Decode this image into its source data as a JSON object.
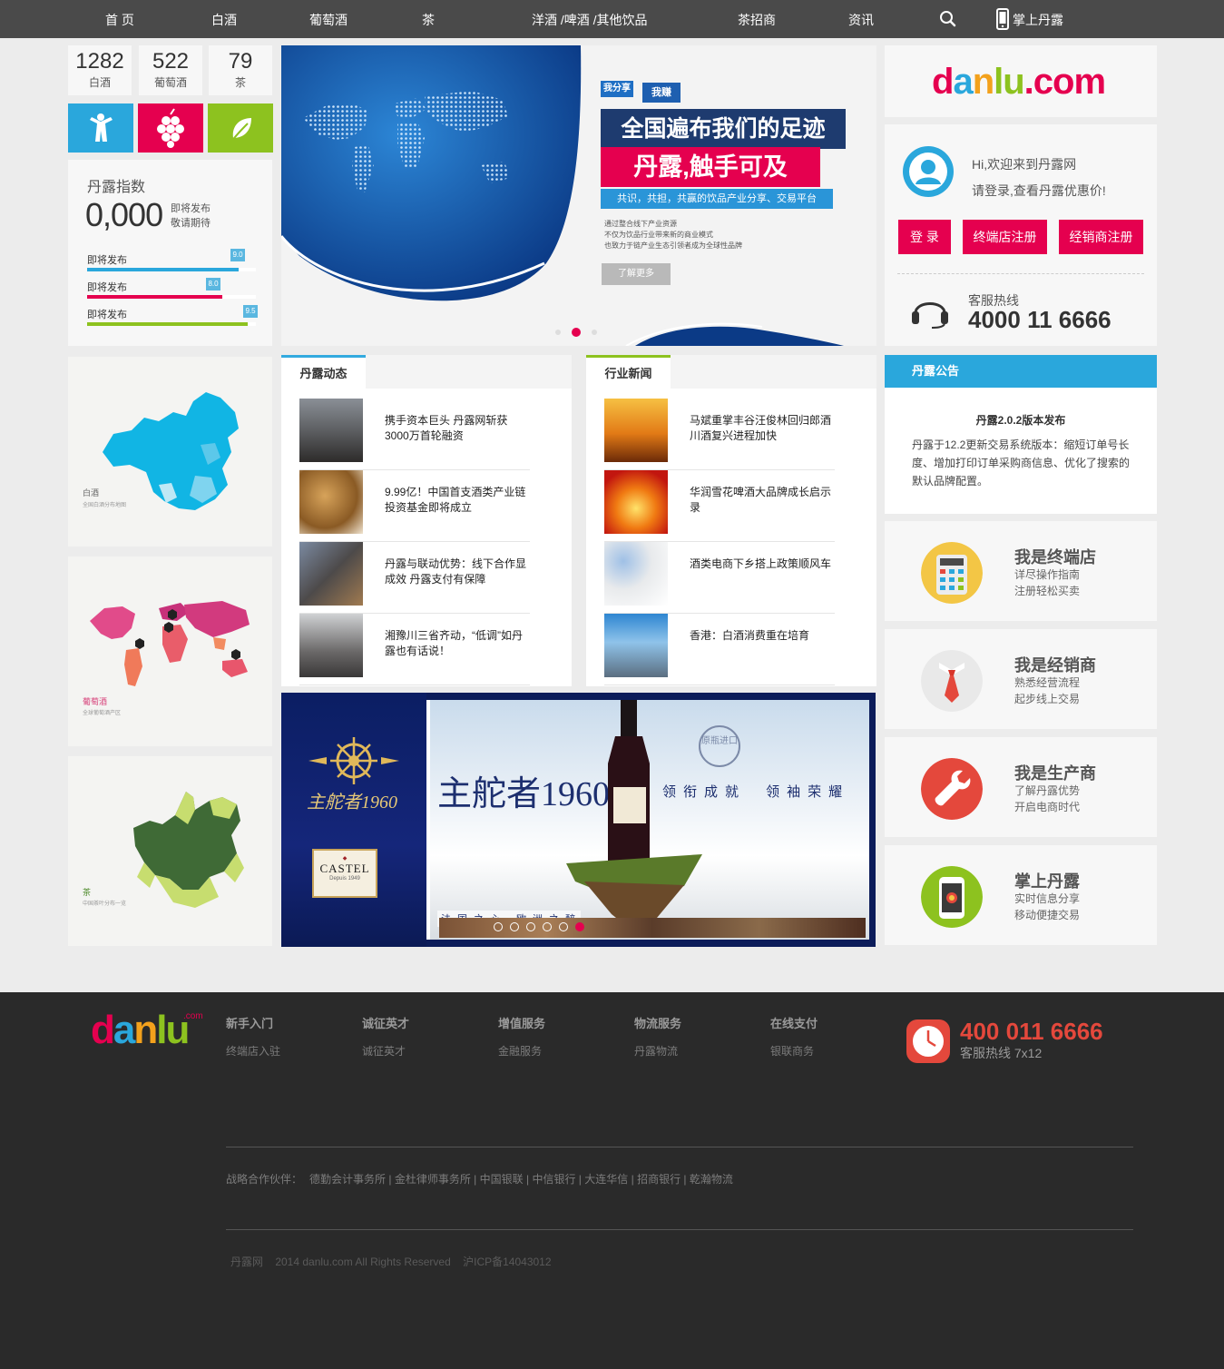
{
  "nav": {
    "items": [
      "首 页",
      "白酒",
      "葡萄酒",
      "茶",
      "洋酒 /啤酒 /其他饮品",
      "茶招商",
      "资讯"
    ],
    "mobile_label": "掌上丹露"
  },
  "stats": [
    {
      "value": "1282",
      "label": "白酒"
    },
    {
      "value": "522",
      "label": "葡萄酒"
    },
    {
      "value": "79",
      "label": "茶"
    }
  ],
  "category_tiles": [
    {
      "icon": "baijiu-figure-icon",
      "color": "#2aa7dc"
    },
    {
      "icon": "grape-icon",
      "color": "#e5004f"
    },
    {
      "icon": "tea-leaf-icon",
      "color": "#8dc21f"
    }
  ],
  "index": {
    "title": "丹露指数",
    "value": "0,000",
    "note1": "即将发布",
    "note2": "敬请期待",
    "bars": [
      {
        "label": "即将发布",
        "score": "9.0",
        "percent": 90,
        "color": "#2aa7dc"
      },
      {
        "label": "即将发布",
        "score": "8.0",
        "percent": 80,
        "color": "#e5004f"
      },
      {
        "label": "即将发布",
        "score": "9.5",
        "percent": 95,
        "color": "#8dc21f"
      }
    ]
  },
  "banner": {
    "badge1": "我分享",
    "badge2": "我赚",
    "headline1": "全国遍布我们的足迹",
    "headline2": "丹露,触手可及",
    "tagline": "共识，共担，共赢的饮品产业分享、交易平台",
    "desc": [
      "通过整合线下产业资源",
      "不仅为饮品行业带来新的商业模式",
      "也致力于链产业生态引领者成为全球性品牌"
    ],
    "more": "了解更多"
  },
  "maps": [
    {
      "caption": "白酒",
      "sub": "全国白酒分布地图",
      "color": "#11b5e4"
    },
    {
      "caption": "葡萄酒",
      "sub": "全球葡萄酒产区",
      "color": "#d7417a"
    },
    {
      "caption": "茶",
      "sub": "中国茶叶分布一览",
      "color": "#3f6a36"
    }
  ],
  "news_dynamic": {
    "tab": "丹露动态",
    "items": [
      "携手资本巨头 丹露网斩获3000万首轮融资",
      "9.99亿！中国首支酒类产业链投资基金即将成立",
      "丹露与联动优势：线下合作显成效 丹露支付有保障",
      "湘豫川三省齐动，“低调”如丹露也有话说！"
    ]
  },
  "news_industry": {
    "tab": "行业新闻",
    "items": [
      "马斌重掌丰谷汪俊林回归郎酒川酒复兴进程加快",
      "华润雪花啤酒大品牌成长启示录",
      "酒类电商下乡搭上政策顺风车",
      "香港：白酒消费重在培育"
    ]
  },
  "ad": {
    "brand_cn": "主舵者1960",
    "brand_logo": "主舵者1960",
    "castel": "CASTEL",
    "castel_sub": "Depuis 1949",
    "slogan": [
      "领",
      "衔",
      "成",
      "就",
      "领",
      "袖",
      "荣",
      "耀"
    ],
    "bottom": "法 国 之 心 · 欧 洲 之 醉",
    "stamp": "原瓶进口"
  },
  "login": {
    "logo_dan": "d",
    "logo_a": "a",
    "logo_n": "n",
    "logo_lu": "lu",
    "logo_com": ".com",
    "greeting": "Hi,欢迎来到丹露网",
    "prompt": "请登录,查看丹露优惠价!",
    "btn_login": "登 录",
    "btn_terminal": "终端店注册",
    "btn_dealer": "经销商注册",
    "hotline_label": "客服热线",
    "hotline": "4000 11 6666"
  },
  "notice": {
    "header": "丹露公告",
    "title": "丹露2.0.2版本发布",
    "body": "丹露于12.2更新交易系统版本：缩短订单号长度、增加打印订单采购商信息、优化了搜索的默认品牌配置。"
  },
  "roles": [
    {
      "title": "我是终端店",
      "l1": "详尽操作指南",
      "l2": "注册轻松买卖",
      "color": "#f3c645",
      "icon": "calculator-icon"
    },
    {
      "title": "我是经销商",
      "l1": "熟悉经营流程",
      "l2": "起步线上交易",
      "color": "#e9e9e9",
      "icon": "necktie-icon"
    },
    {
      "title": "我是生产商",
      "l1": "了解丹露优势",
      "l2": "开启电商时代",
      "color": "#e4483c",
      "icon": "wrench-icon"
    },
    {
      "title": "掌上丹露",
      "l1": "实时信息分享",
      "l2": "移动便捷交易",
      "color": "#8dc21f",
      "icon": "mobile-phone-icon"
    }
  ],
  "footer": {
    "logo_com": ".com",
    "cols": [
      {
        "head": "新手入门",
        "link": "终端店入驻"
      },
      {
        "head": "诚征英才",
        "link": "诚征英才"
      },
      {
        "head": "增值服务",
        "link": "金融服务"
      },
      {
        "head": "物流服务",
        "link": "丹露物流"
      },
      {
        "head": "在线支付",
        "link": "银联商务"
      }
    ],
    "phone": "400 011 6666",
    "phone_sub": "客服热线 7x12",
    "partners_label": "战略合作伙伴：",
    "partners": [
      "德勤会计事务所",
      "金杜律师事务所",
      "中国银联",
      "中信银行",
      "大连华信",
      "招商银行",
      "乾瀚物流"
    ],
    "copyright": "丹露网    2014 danlu.com All Rights Reserved    沪ICP备14043012"
  }
}
